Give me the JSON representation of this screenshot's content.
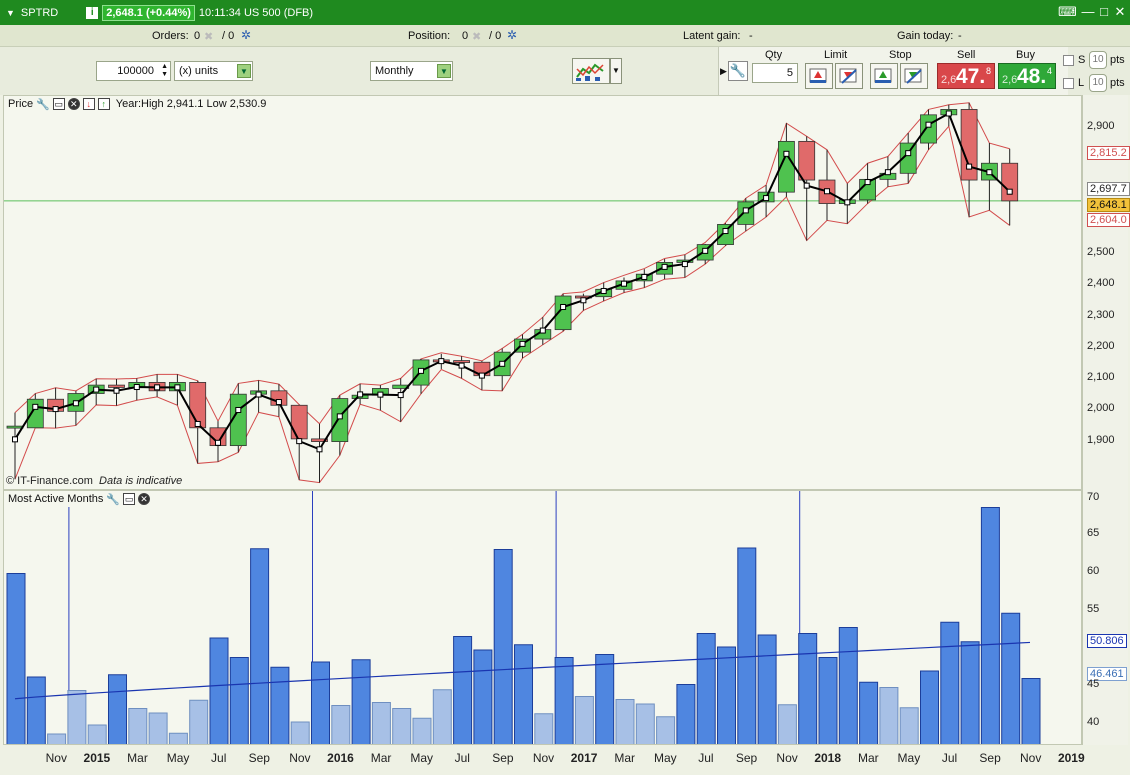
{
  "titlebar": {
    "instrument": "SPTRD",
    "info_glyph": "i",
    "price_change": "2,648.1 (+0.44%)",
    "clock_market": "10:11:34 US 500 (DFB)"
  },
  "info": {
    "orders_label": "Orders:",
    "orders_value": "0",
    "orders_sep": "/ 0",
    "position_label": "Position:",
    "position_value": "0",
    "position_sep": "/ 0",
    "latent_label": "Latent gain:",
    "latent_value": "-",
    "today_label": "Gain today:",
    "today_value": "-"
  },
  "controls": {
    "quantity_value": "100000",
    "units_value": "(x) units",
    "period_value": "Monthly"
  },
  "trade": {
    "qty_header": "Qty",
    "limit_header": "Limit",
    "stop_header": "Stop",
    "sell_header": "Sell",
    "buy_header": "Buy",
    "qty_value": "5",
    "sell_small": "2,6",
    "sell_big": "47.",
    "sell_sup": "8",
    "buy_small": "2,6",
    "buy_big": "48.",
    "buy_sup": "4",
    "s_label": "S",
    "l_label": "L",
    "s_pts": "10",
    "l_pts": "10",
    "pts_label": "pts"
  },
  "price_panel": {
    "label": "Price",
    "yearinfo": "Year:High 2,941.1 Low 2,530.9",
    "footer": "© IT-Finance.com",
    "footer_note": "Data is indicative",
    "y_labels": [
      "2,900",
      "2,500",
      "2,400",
      "2,300",
      "2,200",
      "2,100",
      "2,000",
      "1,900"
    ],
    "tags": {
      "t1": "2,815.2",
      "t2": "2,697.7",
      "t3": "2,648.1",
      "t4": "2,604.0"
    }
  },
  "volume_panel": {
    "label": "Most Active Months",
    "y_labels": [
      "70",
      "65",
      "60",
      "55",
      "45",
      "40"
    ],
    "tags": {
      "t1": "50.806",
      "t2": "46.461"
    }
  },
  "x_axis": [
    "Nov",
    "2015",
    "Mar",
    "May",
    "Jul",
    "Sep",
    "Nov",
    "2016",
    "Mar",
    "May",
    "Jul",
    "Sep",
    "Nov",
    "2017",
    "Mar",
    "May",
    "Jul",
    "Sep",
    "Nov",
    "2018",
    "Mar",
    "May",
    "Jul",
    "Sep",
    "Nov",
    "2019"
  ],
  "chart_data": {
    "type": "candlestick",
    "title": "",
    "period": "Monthly",
    "x_start": "Oct 2014",
    "x_end": "Dec 2018",
    "ohlc": [
      [
        1973,
        2018,
        1820,
        1978
      ],
      [
        1973,
        2075,
        1973,
        2058
      ],
      [
        2058,
        2092,
        1972,
        2022
      ],
      [
        2022,
        2083,
        1980,
        2075
      ],
      [
        2075,
        2119,
        2041,
        2100
      ],
      [
        2100,
        2118,
        2039,
        2093
      ],
      [
        2093,
        2120,
        2055,
        2108
      ],
      [
        2108,
        2132,
        2065,
        2083
      ],
      [
        2083,
        2132,
        2040,
        2108
      ],
      [
        2108,
        2113,
        1867,
        1973
      ],
      [
        1973,
        1993,
        1872,
        1920
      ],
      [
        1920,
        2105,
        1900,
        2073
      ],
      [
        2073,
        2114,
        2019,
        2083
      ],
      [
        2083,
        2103,
        2006,
        2040
      ],
      [
        2040,
        2042,
        1818,
        1940
      ],
      [
        1940,
        1985,
        1810,
        1932
      ],
      [
        1932,
        2070,
        1891,
        2060
      ],
      [
        2060,
        2104,
        2043,
        2070
      ],
      [
        2070,
        2100,
        2025,
        2090
      ],
      [
        2090,
        2120,
        1991,
        2100
      ],
      [
        2100,
        2178,
        2074,
        2175
      ],
      [
        2175,
        2193,
        2148,
        2173
      ],
      [
        2173,
        2186,
        2120,
        2168
      ],
      [
        2168,
        2172,
        2085,
        2128
      ],
      [
        2128,
        2209,
        2083,
        2198
      ],
      [
        2198,
        2251,
        2180,
        2237
      ],
      [
        2237,
        2302,
        2220,
        2265
      ],
      [
        2265,
        2372,
        2260,
        2365
      ],
      [
        2365,
        2372,
        2322,
        2363
      ],
      [
        2363,
        2405,
        2350,
        2385
      ],
      [
        2385,
        2420,
        2375,
        2410
      ],
      [
        2410,
        2445,
        2390,
        2430
      ],
      [
        2430,
        2475,
        2415,
        2465
      ],
      [
        2465,
        2488,
        2420,
        2472
      ],
      [
        2472,
        2520,
        2460,
        2518
      ],
      [
        2518,
        2582,
        2515,
        2578
      ],
      [
        2578,
        2656,
        2558,
        2645
      ],
      [
        2645,
        2695,
        2600,
        2674
      ],
      [
        2674,
        2879,
        2660,
        2825
      ],
      [
        2825,
        2840,
        2530,
        2710
      ],
      [
        2710,
        2800,
        2590,
        2640
      ],
      [
        2640,
        2700,
        2580,
        2651
      ],
      [
        2651,
        2760,
        2640,
        2712
      ],
      [
        2712,
        2780,
        2690,
        2730
      ],
      [
        2730,
        2850,
        2700,
        2820
      ],
      [
        2820,
        2920,
        2800,
        2904
      ],
      [
        2904,
        2934,
        2870,
        2920
      ],
      [
        2920,
        2940,
        2600,
        2710
      ],
      [
        2710,
        2820,
        2620,
        2760
      ],
      [
        2760,
        2803,
        2575,
        2648
      ]
    ],
    "volume": [
      60.0,
      46.2,
      38.6,
      44.4,
      39.8,
      46.5,
      42.0,
      41.4,
      38.7,
      43.1,
      51.4,
      48.8,
      63.3,
      47.5,
      40.2,
      48.2,
      42.4,
      48.5,
      42.8,
      42.0,
      40.7,
      44.5,
      51.6,
      49.8,
      63.2,
      50.5,
      41.3,
      48.8,
      43.6,
      49.2,
      43.2,
      42.6,
      40.9,
      45.2,
      52.0,
      50.2,
      63.4,
      51.8,
      42.5,
      52.0,
      48.8,
      52.8,
      45.5,
      44.8,
      42.1,
      47.0,
      53.5,
      50.9,
      68.8,
      54.7,
      46.0
    ],
    "volume_avg_start": 43.3,
    "volume_avg_end": 50.806,
    "price_y_range": [
      1785,
      2960
    ],
    "volume_y_range": [
      37,
      71
    ]
  }
}
